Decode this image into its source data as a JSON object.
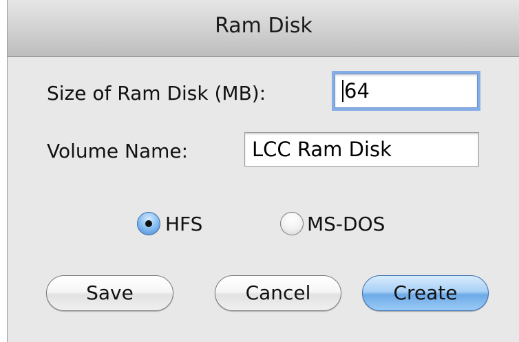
{
  "window": {
    "title": "Ram Disk"
  },
  "form": {
    "size_label": "Size of Ram Disk (MB):",
    "size_value": "64",
    "volume_label": "Volume Name:",
    "volume_value": "LCC Ram Disk"
  },
  "format": {
    "options": [
      {
        "label": "HFS",
        "selected": true
      },
      {
        "label": "MS-DOS",
        "selected": false
      }
    ]
  },
  "buttons": {
    "save_label": "Save",
    "cancel_label": "Cancel",
    "create_label": "Create"
  },
  "colors": {
    "default_button": "#86bdf0",
    "focus_ring": "#86aee6"
  }
}
